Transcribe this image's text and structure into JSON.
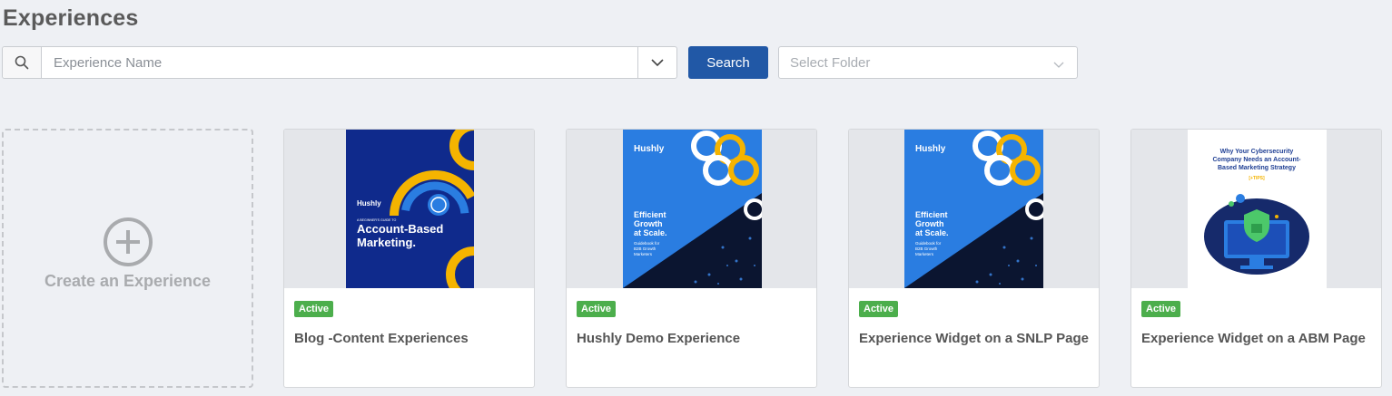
{
  "page": {
    "title": "Experiences"
  },
  "search": {
    "placeholder": "Experience Name",
    "button_label": "Search",
    "folder_placeholder": "Select Folder"
  },
  "create_card": {
    "label": "Create an Experience"
  },
  "cards": [
    {
      "status": "Active",
      "name": "Blog -Content Experiences",
      "thumb": {
        "brand": "Hushly",
        "kicker": "A BEGINNER'S GUIDE TO",
        "headline1": "Account-Based",
        "headline2": "Marketing."
      }
    },
    {
      "status": "Active",
      "name": "Hushly Demo Experience",
      "thumb": {
        "brand": "Hushly",
        "headline1": "Efficient",
        "headline2": "Growth",
        "headline3": "at Scale.",
        "sub1": "Guidebook for",
        "sub2": "B2B Growth",
        "sub3": "Marketers"
      }
    },
    {
      "status": "Active",
      "name": "Experience Widget on a SNLP Page",
      "thumb": {
        "brand": "Hushly",
        "headline1": "Efficient",
        "headline2": "Growth",
        "headline3": "at Scale.",
        "sub1": "Guidebook for",
        "sub2": "B2B Growth",
        "sub3": "Marketers"
      }
    },
    {
      "status": "Active",
      "name": "Experience Widget on a ABM Page",
      "thumb": {
        "line1": "Why Your Cybersecurity",
        "line2": "Company Needs an Account-",
        "line3": "Based Marketing Strategy",
        "tag": "[+TIPS]"
      }
    }
  ],
  "colors": {
    "accent": "#2158a6",
    "active": "#4cae4c",
    "navy": "#0f2a8c",
    "blue": "#2a7de1",
    "yellow": "#f5b400"
  }
}
